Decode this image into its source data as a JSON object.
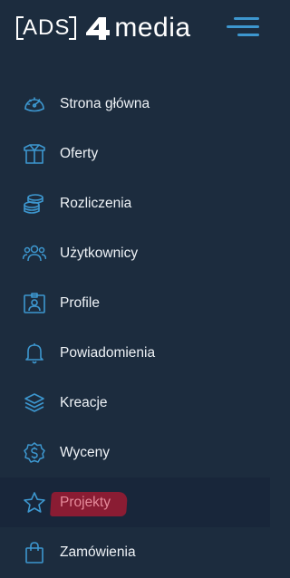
{
  "brand": {
    "logo_ads": "ADS",
    "logo_media": "media",
    "accent_color": "#3d97cf",
    "highlight_color": "#8a1c33"
  },
  "header": {
    "menu_toggle_icon": "hamburger-menu-icon"
  },
  "nav": {
    "items": [
      {
        "label": "Strona główna",
        "icon": "dashboard-gauge-icon"
      },
      {
        "label": "Oferty",
        "icon": "box-icon"
      },
      {
        "label": "Rozliczenia",
        "icon": "coins-icon"
      },
      {
        "label": "Użytkownicy",
        "icon": "users-icon"
      },
      {
        "label": "Profile",
        "icon": "id-card-icon"
      },
      {
        "label": "Powiadomienia",
        "icon": "bell-icon"
      },
      {
        "label": "Kreacje",
        "icon": "layers-icon"
      },
      {
        "label": "Wyceny",
        "icon": "dollar-badge-icon"
      },
      {
        "label": "Projekty",
        "icon": "star-icon",
        "active": true
      },
      {
        "label": "Zamówienia",
        "icon": "shopping-bag-icon"
      }
    ]
  }
}
